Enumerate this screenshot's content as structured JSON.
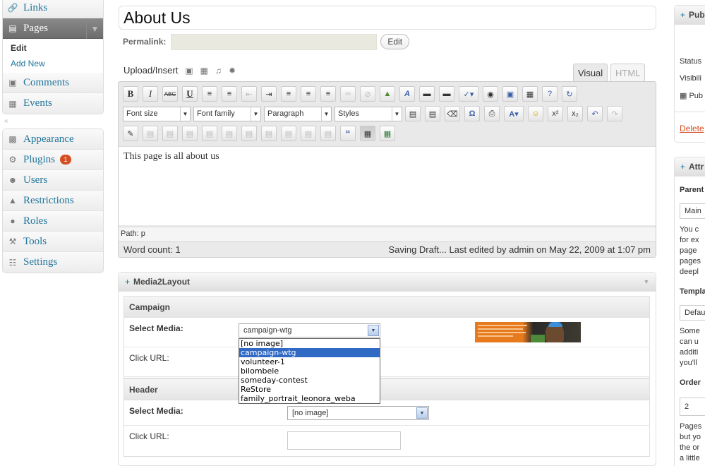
{
  "sidebar": {
    "links": "Links",
    "pages": "Pages",
    "pages_sub": [
      "Edit",
      "Add New"
    ],
    "comments": "Comments",
    "events": "Events",
    "appearance": "Appearance",
    "plugins": "Plugins",
    "plugins_badge": "1",
    "users": "Users",
    "restrictions": "Restrictions",
    "roles": "Roles",
    "tools": "Tools",
    "settings": "Settings"
  },
  "editor": {
    "title": "About Us",
    "permalink_label": "Permalink:",
    "permalink_edit": "Edit",
    "upload_insert": "Upload/Insert",
    "tab_visual": "Visual",
    "tab_html": "HTML",
    "font_size": "Font size",
    "font_family": "Font family",
    "format": "Paragraph",
    "styles": "Styles",
    "content": "This page is all about us",
    "path": "Path: p",
    "word_count": "Word count: 1",
    "save_status": "Saving Draft... Last edited by admin on May 22, 2009 at 1:07 pm"
  },
  "media2layout": {
    "title": "Media2Layout",
    "campaign": {
      "heading": "Campaign",
      "select_label": "Select Media:",
      "selected": "campaign-wtg",
      "url_label": "Click URL:"
    },
    "dropdown_options": [
      "[no image]",
      "campaign-wtg",
      "volunteer-1",
      "bilombele",
      "someday-contest",
      "ReStore",
      "family_portrait_leonora_weba"
    ],
    "dropdown_selected_index": 1,
    "header": {
      "heading": "Header",
      "select_label": "Select Media:",
      "selected": "[no image]",
      "url_label": "Click URL:"
    }
  },
  "right": {
    "publish_title": "Pub",
    "status": "Status",
    "visibility": "Visibili",
    "publish": "Pub",
    "delete": "Delete",
    "attributes_title": "Attr",
    "parent": "Parent",
    "parent_value": "Main",
    "parent_help": [
      "You c",
      "for ex",
      "page",
      "pages",
      "deepl"
    ],
    "template": "Templat",
    "template_value": "Defau",
    "template_help": [
      "Some",
      "can u",
      "additi",
      "you'll"
    ],
    "order": "Order",
    "order_value": "2",
    "order_help": [
      "Pages",
      "but yo",
      "the or",
      "a little"
    ]
  },
  "colors": {
    "link": "#21759b",
    "delete": "#d54e21",
    "current_menu": "#6d6d6d",
    "badge": "#d54e21",
    "selection": "#316ac5"
  }
}
